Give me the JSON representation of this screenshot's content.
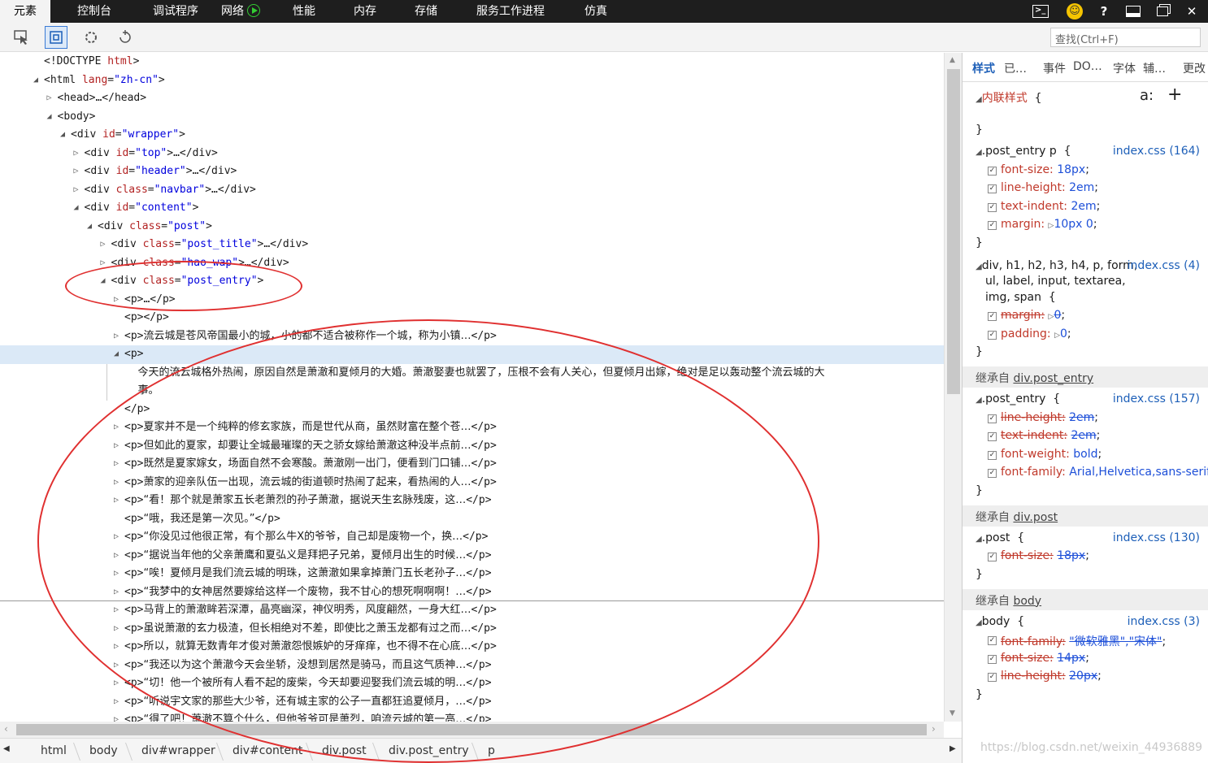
{
  "tabs": [
    "元素",
    "控制台",
    "调试程序",
    "网络",
    "性能",
    "内存",
    "存储",
    "服务工作进程",
    "仿真"
  ],
  "find_placeholder": "查找(Ctrl+F)",
  "dom": [
    {
      "indent": 0,
      "tri": "",
      "html": "<span class='tg'>&lt;!DOCTYPE </span><span class='an'>html</span><span class='tg'>&gt;</span>"
    },
    {
      "indent": 0,
      "tri": "down",
      "html": "<span class='tg'>&lt;html </span><span class='an'>lang</span>=<span class='av'>\"zh-cn\"</span><span class='tg'>&gt;</span>"
    },
    {
      "indent": 1,
      "tri": "right",
      "html": "<span class='tg'>&lt;head&gt;…&lt;/head&gt;</span>"
    },
    {
      "indent": 1,
      "tri": "down",
      "html": "<span class='tg'>&lt;body&gt;</span>"
    },
    {
      "indent": 2,
      "tri": "down",
      "html": "<span class='tg'>&lt;div </span><span class='an'>id</span>=<span class='av'>\"wrapper\"</span><span class='tg'>&gt;</span>"
    },
    {
      "indent": 3,
      "tri": "right",
      "html": "<span class='tg'>&lt;div </span><span class='an'>id</span>=<span class='av'>\"top\"</span><span class='tg'>&gt;…&lt;/div&gt;</span>"
    },
    {
      "indent": 3,
      "tri": "right",
      "html": "<span class='tg'>&lt;div </span><span class='an'>id</span>=<span class='av'>\"header\"</span><span class='tg'>&gt;…&lt;/div&gt;</span>"
    },
    {
      "indent": 3,
      "tri": "right",
      "html": "<span class='tg'>&lt;div </span><span class='an'>class</span>=<span class='av'>\"navbar\"</span><span class='tg'>&gt;…&lt;/div&gt;</span>"
    },
    {
      "indent": 3,
      "tri": "down",
      "html": "<span class='tg'>&lt;div </span><span class='an'>id</span>=<span class='av'>\"content\"</span><span class='tg'>&gt;</span>"
    },
    {
      "indent": 4,
      "tri": "down",
      "html": "<span class='tg'>&lt;div </span><span class='an'>class</span>=<span class='av'>\"post\"</span><span class='tg'>&gt;</span>"
    },
    {
      "indent": 5,
      "tri": "right",
      "html": "<span class='tg'>&lt;div </span><span class='an'>class</span>=<span class='av'>\"post_title\"</span><span class='tg'>&gt;…&lt;/div&gt;</span>"
    },
    {
      "indent": 5,
      "tri": "right",
      "html": "<span class='tg'>&lt;div </span><span class='an'>class</span>=<span class='av'>\"hao_wap\"</span><span class='tg'>&gt;…&lt;/div&gt;</span>"
    },
    {
      "indent": 5,
      "tri": "down",
      "html": "<span class='tg'>&lt;div </span><span class='an'>class</span>=<span class='av'>\"post_entry\"</span><span class='tg'>&gt;</span>"
    },
    {
      "indent": 6,
      "tri": "right",
      "html": "<span class='tg'>&lt;p&gt;…&lt;/p&gt;</span>"
    },
    {
      "indent": 6,
      "tri": "",
      "html": "<span class='tg'>&lt;p&gt;&lt;/p&gt;</span>"
    },
    {
      "indent": 6,
      "tri": "right",
      "html": "<span class='tg'>&lt;p&gt;</span><span class='tx'>流云城是苍风帝国最小的城，小的都不适合被称作一个城，称为小镇…</span><span class='tg'>&lt;/p&gt;</span>"
    },
    {
      "indent": 6,
      "tri": "down",
      "sel": true,
      "html": "<span class='tg'>&lt;p&gt;</span>"
    },
    {
      "indent": 7,
      "tri": "",
      "guide": true,
      "html": "<span class='tx'>今天的流云城格外热闹，原因自然是萧澈和夏倾月的大婚。萧澈娶妻也就罢了，压根不会有人关心，但夏倾月出嫁，绝对是足以轰动整个流云城的大</span>"
    },
    {
      "indent": 7,
      "tri": "",
      "guide": true,
      "html": "<span class='tx'>事。</span>"
    },
    {
      "indent": 6,
      "tri": "",
      "html": "<span class='tg'>&lt;/p&gt;</span>"
    },
    {
      "indent": 6,
      "tri": "right",
      "html": "<span class='tg'>&lt;p&gt;</span><span class='tx'>夏家并不是一个纯粹的修玄家族，而是世代从商，虽然财富在整个苍…</span><span class='tg'>&lt;/p&gt;</span>"
    },
    {
      "indent": 6,
      "tri": "right",
      "html": "<span class='tg'>&lt;p&gt;</span><span class='tx'>但如此的夏家，却要让全城最璀璨的天之骄女嫁给萧澈这种没半点前…</span><span class='tg'>&lt;/p&gt;</span>"
    },
    {
      "indent": 6,
      "tri": "right",
      "html": "<span class='tg'>&lt;p&gt;</span><span class='tx'>既然是夏家嫁女，场面自然不会寒酸。萧澈刚一出门，便看到门口铺…</span><span class='tg'>&lt;/p&gt;</span>"
    },
    {
      "indent": 6,
      "tri": "right",
      "html": "<span class='tg'>&lt;p&gt;</span><span class='tx'>萧家的迎亲队伍一出现，流云城的街道顿时热闹了起来，看热闹的人…</span><span class='tg'>&lt;/p&gt;</span>"
    },
    {
      "indent": 6,
      "tri": "right",
      "html": "<span class='tg'>&lt;p&gt;</span><span class='tx'>“看！那个就是萧家五长老萧烈的孙子萧澈，据说天生玄脉残废，这…</span><span class='tg'>&lt;/p&gt;</span>"
    },
    {
      "indent": 6,
      "tri": "",
      "html": "<span class='tg'>&lt;p&gt;</span><span class='tx'>“哦，我还是第一次见。”</span><span class='tg'>&lt;/p&gt;</span>"
    },
    {
      "indent": 6,
      "tri": "right",
      "html": "<span class='tg'>&lt;p&gt;</span><span class='tx'>“你没见过他很正常，有个那么牛X的爷爷，自己却是废物一个，换…</span><span class='tg'>&lt;/p&gt;</span>"
    },
    {
      "indent": 6,
      "tri": "right",
      "html": "<span class='tg'>&lt;p&gt;</span><span class='tx'>“据说当年他的父亲萧鹰和夏弘义是拜把子兄弟，夏倾月出生的时候…</span><span class='tg'>&lt;/p&gt;</span>"
    },
    {
      "indent": 6,
      "tri": "right",
      "html": "<span class='tg'>&lt;p&gt;</span><span class='tx'>“唉！夏倾月是我们流云城的明珠，这萧澈如果拿掉萧门五长老孙子…</span><span class='tg'>&lt;/p&gt;</span>"
    },
    {
      "indent": 6,
      "tri": "right",
      "html": "<span class='tg'>&lt;p&gt;</span><span class='tx'>“我梦中的女神居然要嫁给这样一个废物，我不甘心的想死啊啊啊！…</span><span class='tg'>&lt;/p&gt;</span>"
    },
    {
      "indent": 6,
      "tri": "right",
      "html": "<span class='tg'>&lt;p&gt;</span><span class='tx'>马背上的萧澈眸若深潭，晶亮幽深，神仪明秀，风度翩然，一身大红…</span><span class='tg'>&lt;/p&gt;</span>"
    },
    {
      "indent": 6,
      "tri": "right",
      "html": "<span class='tg'>&lt;p&gt;</span><span class='tx'>虽说萧澈的玄力极渣，但长相绝对不差，即使比之萧玉龙都有过之而…</span><span class='tg'>&lt;/p&gt;</span>"
    },
    {
      "indent": 6,
      "tri": "right",
      "html": "<span class='tg'>&lt;p&gt;</span><span class='tx'>所以，就算无数青年才俊对萧澈怨恨嫉妒的牙痒痒，也不得不在心底…</span><span class='tg'>&lt;/p&gt;</span>"
    },
    {
      "indent": 6,
      "tri": "right",
      "html": "<span class='tg'>&lt;p&gt;</span><span class='tx'>“我还以为这个萧澈今天会坐轿，没想到居然是骑马，而且这气质神…</span><span class='tg'>&lt;/p&gt;</span>"
    },
    {
      "indent": 6,
      "tri": "right",
      "html": "<span class='tg'>&lt;p&gt;</span><span class='tx'>“切！他一个被所有人看不起的废柴，今天却要迎娶我们流云城的明…</span><span class='tg'>&lt;/p&gt;</span>"
    },
    {
      "indent": 6,
      "tri": "right",
      "html": "<span class='tg'>&lt;p&gt;</span><span class='tx'>“听说宇文家的那些大少爷，还有城主家的公子一直都狂追夏倾月，…</span><span class='tg'>&lt;/p&gt;</span>"
    },
    {
      "indent": 6,
      "tri": "right",
      "html": "<span class='tg'>&lt;p&gt;</span><span class='tx'>“得了吧！萧澈不算个什么，但他爷爷可是萧烈，咱流云城的第一高…</span><span class='tg'>&lt;/p&gt;</span>"
    }
  ],
  "breadcrumb": [
    "html",
    "body",
    "div#wrapper",
    "div#content",
    "div.post",
    "div.post_entry",
    "p"
  ],
  "side_tabs": [
    "样式",
    "已…",
    "事件",
    "DO…",
    "字体",
    "辅…",
    "更改"
  ],
  "inline_style": "内联样式",
  "rules": [
    {
      "selector": ".post_entry p",
      "src": "index.css (164)",
      "props": [
        [
          "font-size",
          "18px",
          false,
          ""
        ],
        [
          "line-height",
          "2em",
          false,
          ""
        ],
        [
          "text-indent",
          "2em",
          false,
          ""
        ],
        [
          "margin",
          "10px 0",
          false,
          "tri"
        ]
      ]
    },
    {
      "selector": "div, h1, h2, h3, h4, p, form,",
      "selector2": "ul, label, input, textarea,",
      "selector3": "img, span",
      "src": "index.css (4)",
      "props": [
        [
          "margin",
          "0",
          true,
          "tri"
        ],
        [
          "padding",
          "0",
          false,
          "tri"
        ]
      ]
    },
    {
      "inherit": "继承自",
      "inherit_from": "div.post_entry"
    },
    {
      "selector": ".post_entry",
      "src": "index.css (157)",
      "props": [
        [
          "line-height",
          "2em",
          true,
          ""
        ],
        [
          "text-indent",
          "2em",
          true,
          ""
        ],
        [
          "font-weight",
          "bold",
          false,
          ""
        ],
        [
          "font-family",
          "Arial,Helvetica,sans-serif",
          false,
          ""
        ]
      ]
    },
    {
      "inherit": "继承自",
      "inherit_from": "div.post"
    },
    {
      "selector": ".post",
      "src": "index.css (130)",
      "props": [
        [
          "font-size",
          "18px",
          true,
          ""
        ]
      ]
    },
    {
      "inherit": "继承自",
      "inherit_from": "body"
    },
    {
      "selector": "body",
      "src": "index.css (3)",
      "props": [
        [
          "font-family",
          "\"微软雅黑\",\"宋体\"",
          true,
          ""
        ],
        [
          "font-size",
          "14px",
          true,
          ""
        ],
        [
          "line-height",
          "20px",
          true,
          ""
        ]
      ]
    }
  ],
  "watermark": "https://blog.csdn.net/weixin_44936889"
}
